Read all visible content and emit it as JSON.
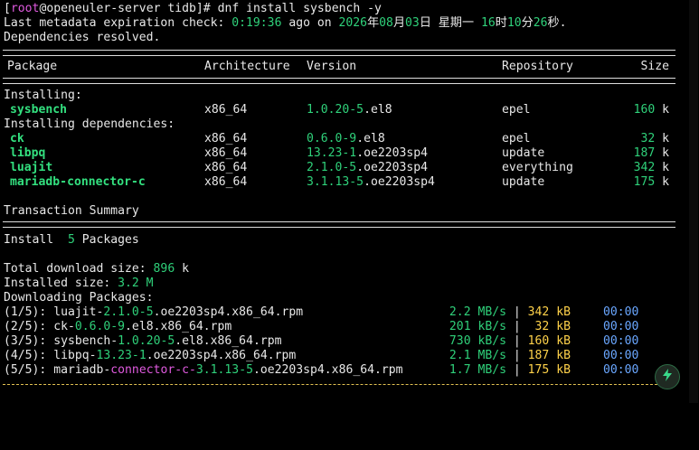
{
  "terminal": {
    "prompt": {
      "open_bracket": "[",
      "user": "root",
      "at": "@",
      "host": "openeuler-server",
      "space": " ",
      "cwd": "tidb",
      "close": "]# ",
      "command": "dnf install sysbench -y"
    },
    "metadata": {
      "prefix": "Last metadata expiration check: ",
      "elapsed": "0:19:36",
      "mid": " ago on ",
      "y": "2026",
      "y_unit": "年",
      "mo": "08",
      "mo_unit": "月",
      "d": "03",
      "d_unit": "日 星期一 ",
      "h": "16",
      "h_unit": "时",
      "mi": "10",
      "mi_unit": "分",
      "s": "26",
      "s_unit": "秒."
    },
    "deps_resolved": "Dependencies resolved.",
    "headers": {
      "package": "Package",
      "arch": "Architecture",
      "version": "Version",
      "repo": "Repository",
      "size": "Size"
    },
    "installing_label": "Installing:",
    "installing_deps_label": "Installing dependencies:",
    "packages": [
      {
        "name": "sysbench",
        "arch": "x86_64",
        "ver_a": "1.0.20-5",
        "ver_b": ".el8",
        "repo": "epel",
        "size_num": "160",
        "size_unit": " k"
      },
      {
        "name": "ck",
        "arch": "x86_64",
        "ver_a": "0.6.0-9",
        "ver_b": ".el8",
        "repo": "epel",
        "size_num": "32",
        "size_unit": " k"
      },
      {
        "name": "libpq",
        "arch": "x86_64",
        "ver_a": "13.23-1",
        "ver_b": ".oe2203sp4",
        "repo": "update",
        "size_num": "187",
        "size_unit": " k"
      },
      {
        "name": "luajit",
        "arch": "x86_64",
        "ver_a": "2.1.0-5",
        "ver_b": ".oe2203sp4",
        "repo": "everything",
        "size_num": "342",
        "size_unit": " k"
      },
      {
        "name": "mariadb-connector-c",
        "arch": "x86_64",
        "ver_a": "3.1.13-5",
        "ver_b": ".oe2203sp4",
        "repo": "update",
        "size_num": "175",
        "size_unit": " k"
      }
    ],
    "transaction_summary": "Transaction Summary",
    "install_summary": {
      "prefix": "Install  ",
      "count": "5",
      "suffix": " Packages"
    },
    "total_download": {
      "prefix": "Total download size: ",
      "num": "896",
      "suffix": " k"
    },
    "installed_size": {
      "prefix": "Installed size: ",
      "value": "3.2 M"
    },
    "downloading": "Downloading Packages:",
    "downloads": [
      {
        "idx": "(1/5)",
        "sep": ": ",
        "n1": "luajit-",
        "v": "2.1.0-5",
        "n2": ".oe2203sp4.x86_64.rpm",
        "rate": "2.2 MB/s",
        "bar": " | ",
        "size": "342 kB",
        "time": "00:00"
      },
      {
        "idx": "(2/5)",
        "sep": ": ",
        "n1": "ck-",
        "v": "0.6.0-9",
        "n2": ".el8.x86_64.rpm",
        "rate": "201 kB/s",
        "bar": " | ",
        "size": " 32 kB",
        "time": "00:00"
      },
      {
        "idx": "(3/5)",
        "sep": ": ",
        "n1": "sysbench-",
        "v": "1.0.20-5",
        "n2": ".el8.x86_64.rpm",
        "rate": "730 kB/s",
        "bar": " | ",
        "size": "160 kB",
        "time": "00:00"
      },
      {
        "idx": "(4/5)",
        "sep": ": ",
        "n1": "libpq-",
        "v": "13.23-1",
        "n2": ".oe2203sp4.x86_64.rpm",
        "rate": "2.1 MB/s",
        "bar": " | ",
        "size": "187 kB",
        "time": "00:00"
      },
      {
        "idx": "(5/5)",
        "sep": ": ",
        "n1": "mariadb-",
        "n1b": "connector-c-",
        "v": "3.1.13-5",
        "n2": ".oe2203sp4.x86_64.rpm",
        "rate": "1.7 MB/s",
        "bar": " | ",
        "size": "175 kB",
        "time": "00:00"
      }
    ]
  },
  "colors": {
    "background": "#000000",
    "text": "#e8e8e8",
    "green": "#2fd17a",
    "magenta": "#e05adf",
    "yellow": "#ffd24a",
    "blue": "#6aa7ff"
  },
  "icons": {
    "action_button": "lightning-bolt-icon"
  }
}
